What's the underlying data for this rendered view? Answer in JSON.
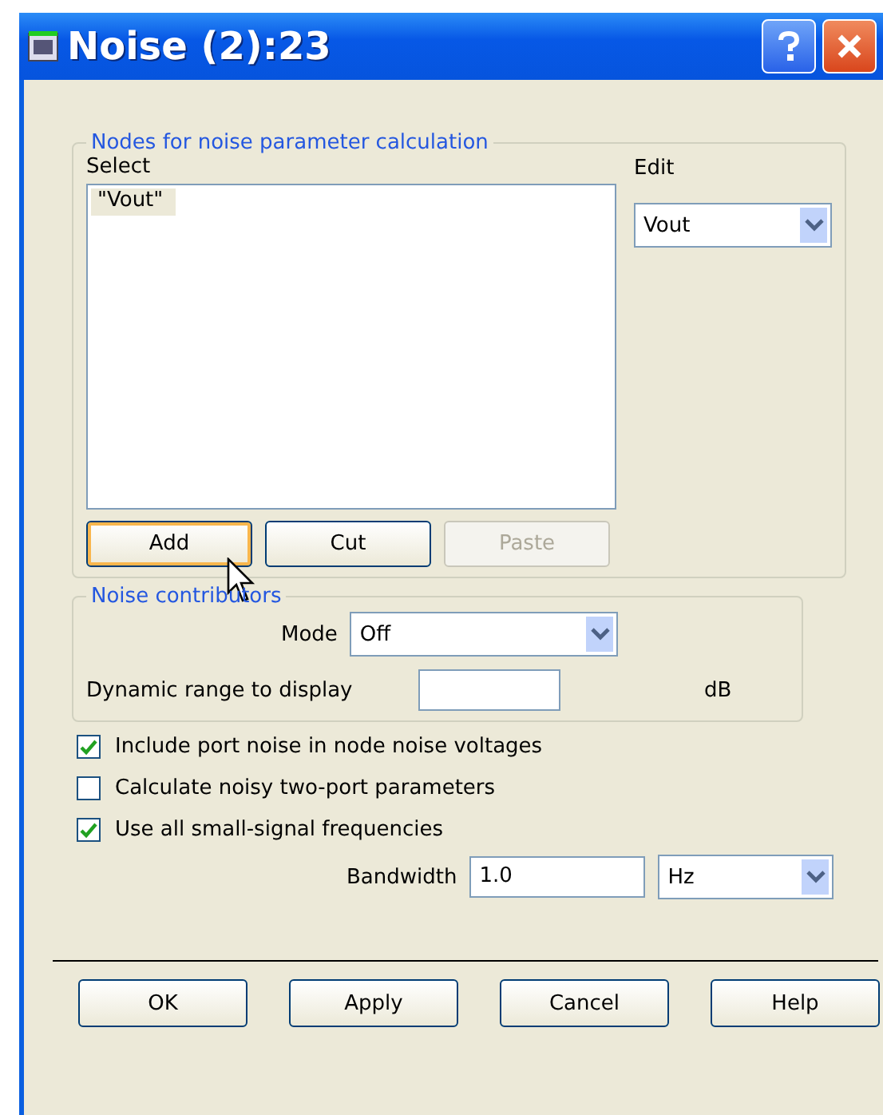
{
  "window": {
    "title": "Noise (2):23"
  },
  "nodes_group": {
    "title": "Nodes for noise parameter calculation",
    "select_label": "Select",
    "items": [
      {
        "label": "\"Vout\"",
        "selected": true
      }
    ],
    "edit_label": "Edit",
    "edit_value": "Vout",
    "buttons": [
      {
        "label": "Add",
        "focused": true,
        "disabled": false
      },
      {
        "label": "Cut",
        "focused": false,
        "disabled": false
      },
      {
        "label": "Paste",
        "focused": false,
        "disabled": true
      }
    ]
  },
  "contributors_group": {
    "title": "Noise contributors",
    "mode_label": "Mode",
    "mode_value": "Off",
    "range_label": "Dynamic range to display",
    "range_unit": "dB"
  },
  "options": [
    {
      "label": "Include port noise in node noise voltages",
      "checked": true
    },
    {
      "label": "Calculate noisy two-port parameters",
      "checked": false
    },
    {
      "label": "Use all small-signal frequencies",
      "checked": true
    }
  ],
  "bandwidth": {
    "label": "Bandwidth",
    "value": "1.0",
    "unit": "Hz"
  },
  "buttons": [
    {
      "label": "OK"
    },
    {
      "label": "Apply"
    },
    {
      "label": "Cancel"
    },
    {
      "label": "Help"
    }
  ]
}
